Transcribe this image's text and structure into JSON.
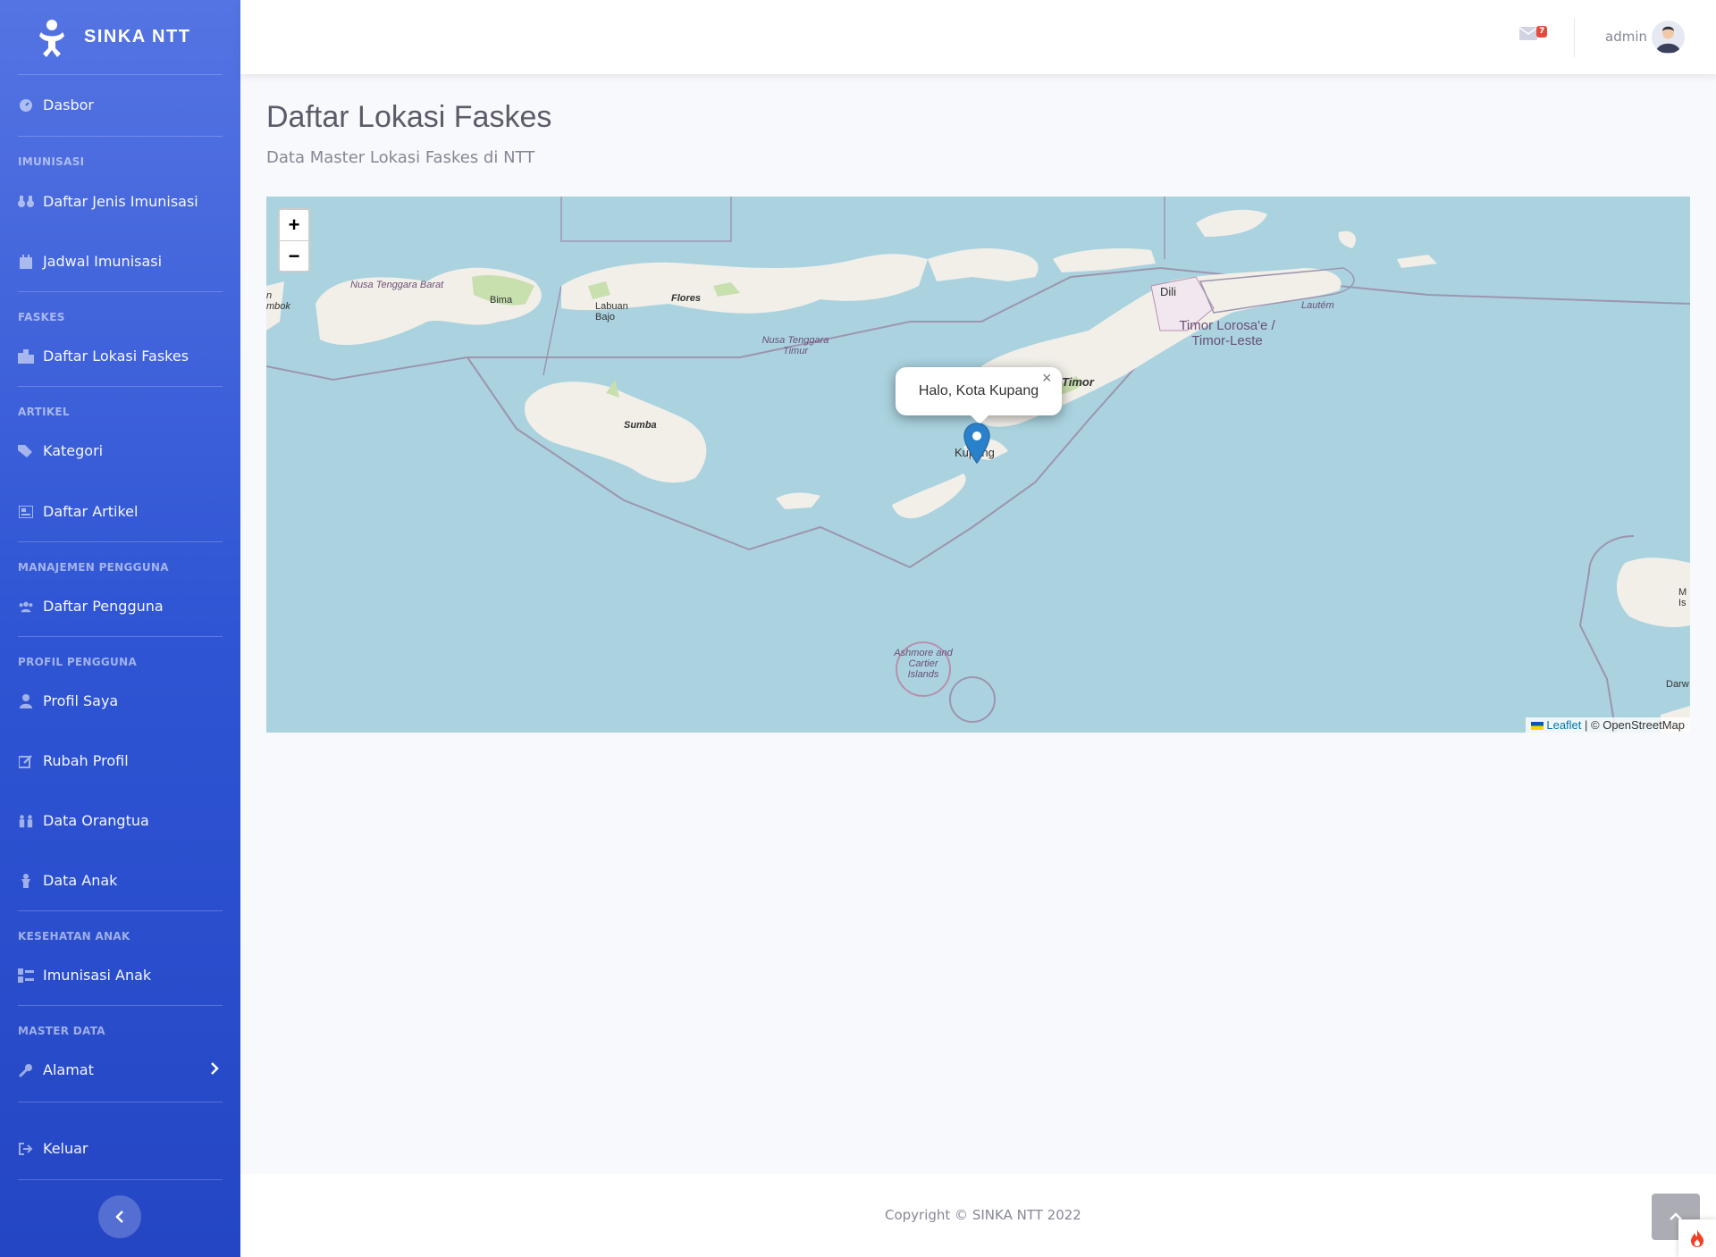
{
  "app": {
    "brand": "SINKA NTT"
  },
  "sidebar": {
    "items": [
      {
        "label": "Dasbor",
        "icon": "tachometer-icon"
      },
      {
        "heading": "IMUNISASI"
      },
      {
        "label": "Daftar Jenis Imunisasi",
        "icon": "binoculars-icon"
      },
      {
        "label": "Jadwal Imunisasi",
        "icon": "calendar-icon"
      },
      {
        "heading": "FASKES"
      },
      {
        "label": "Daftar Lokasi Faskes",
        "icon": "building-icon"
      },
      {
        "heading": "ARTIKEL"
      },
      {
        "label": "Kategori",
        "icon": "tags-icon"
      },
      {
        "label": "Daftar Artikel",
        "icon": "newspaper-icon"
      },
      {
        "heading": "MANAJEMEN PENGGUNA"
      },
      {
        "label": "Daftar Pengguna",
        "icon": "users-icon"
      },
      {
        "heading": "PROFIL PENGGUNA"
      },
      {
        "label": "Profil Saya",
        "icon": "user-icon"
      },
      {
        "label": "Rubah Profil",
        "icon": "edit-icon"
      },
      {
        "label": "Data Orangtua",
        "icon": "family-icon"
      },
      {
        "label": "Data Anak",
        "icon": "child-icon"
      },
      {
        "heading": "KESEHATAN ANAK"
      },
      {
        "label": "Imunisasi Anak",
        "icon": "list-icon"
      },
      {
        "heading": "MASTER DATA"
      },
      {
        "label": "Alamat",
        "icon": "wrench-icon"
      },
      {
        "label": "Keluar",
        "icon": "sign-out-icon"
      }
    ]
  },
  "topbar": {
    "mail_count": "7",
    "username": "admin"
  },
  "page": {
    "title": "Daftar Lokasi Faskes",
    "subtitle": "Data Master Lokasi Faskes di NTT"
  },
  "map": {
    "popup_text": "Halo, Kota Kupang",
    "zoom_in": "+",
    "zoom_out": "−",
    "attribution_link": "Leaflet",
    "attribution_text": "| © OpenStreetMap",
    "labels": {
      "nusa_tenggara_barat": "Nusa Tenggara Barat",
      "bima": "Bima",
      "labuan_bajo": "Labuan Bajo",
      "flores": "Flores",
      "nusa_tenggara_timur": "Nusa Tenggara Timur",
      "sumba": "Sumba",
      "kupang": "Kupang",
      "timor": "Timor",
      "dili": "Dili",
      "timor_leste": "Timor Lorosa'e / Timor-Leste",
      "lautem": "Lautém",
      "ashmore": "Ashmore and Cartier Islands",
      "lombok": "n mbok",
      "darwin": "Darw",
      "melville": "M Is"
    }
  },
  "footer": {
    "copyright": "Copyright © SINKA NTT 2022"
  },
  "colors": {
    "sidebar": "#3c5fd9",
    "map_water": "#aad3df",
    "land": "#f2efe9",
    "badge": "#e74a3b"
  }
}
